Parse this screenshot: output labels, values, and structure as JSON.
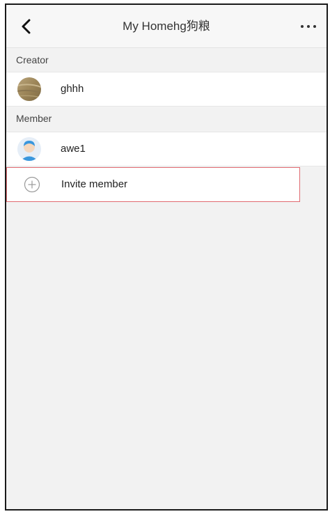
{
  "header": {
    "title": "My Homehg狗粮",
    "back_icon": "chevron-left-icon",
    "more_icon": "more-horizontal-icon"
  },
  "creator_section": {
    "label": "Creator",
    "members": [
      {
        "name": "ghhh",
        "avatar": "photo-avatar"
      }
    ]
  },
  "member_section": {
    "label": "Member",
    "members": [
      {
        "name": "awe1",
        "avatar": "default-user-avatar"
      }
    ]
  },
  "invite": {
    "label": "Invite member",
    "icon": "plus-circle-icon",
    "highlight_color": "#e06a70"
  },
  "colors": {
    "background": "#f2f2f2",
    "row": "#ffffff",
    "avatar_blue": "#3a97dd"
  }
}
